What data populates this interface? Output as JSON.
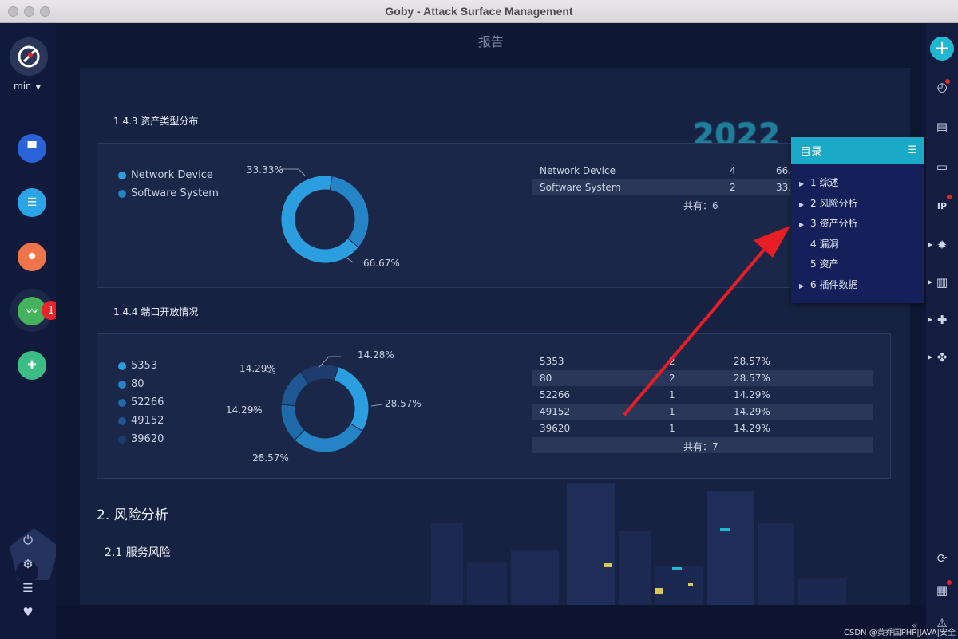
{
  "window": {
    "title": "Goby - Attack Surface Management"
  },
  "user": {
    "name": "mir"
  },
  "leftnav": {
    "badge_count": "1"
  },
  "page": {
    "title": "报告"
  },
  "logo_2022": "2022",
  "section_asset_types": {
    "title": "1.4.3 资产类型分布",
    "legend": [
      "Network Device",
      "Software System"
    ],
    "pct_top": "33.33%",
    "pct_bottom": "66.67%",
    "table": [
      {
        "name": "Network Device",
        "count": "4",
        "pct": "66.6"
      },
      {
        "name": "Software System",
        "count": "2",
        "pct": "33.3"
      }
    ],
    "total": "共有：6"
  },
  "section_ports": {
    "title": "1.4.4 端口开放情况",
    "legend": [
      "5353",
      "80",
      "52266",
      "49152",
      "39620"
    ],
    "labels": {
      "p1": "14.28%",
      "p2": "28.57%",
      "p3": "28.57%",
      "p4": "14.29%",
      "p5": "14.29%"
    },
    "table": [
      {
        "port": "5353",
        "count": "2",
        "pct": "28.57%"
      },
      {
        "port": "80",
        "count": "2",
        "pct": "28.57%"
      },
      {
        "port": "52266",
        "count": "1",
        "pct": "14.29%"
      },
      {
        "port": "49152",
        "count": "1",
        "pct": "14.29%"
      },
      {
        "port": "39620",
        "count": "1",
        "pct": "14.29%"
      }
    ],
    "total": "共有：7"
  },
  "risk": {
    "h2": "2. 风险分析",
    "h3": "2.1 服务风险"
  },
  "toc": {
    "title": "目录",
    "items": [
      "1 综述",
      "2 风险分析",
      "3 资产分析",
      "4 漏洞",
      "5 资产",
      "6 插件数据"
    ]
  },
  "watermark": "CSDN @黄乔国PHP|JAVA|安全",
  "colors": {
    "accent": "#1aa9c6",
    "donut_main": "#2b9ee0",
    "donut_dark": "#2063a8",
    "arrow": "#e81e26"
  },
  "chart_data": [
    {
      "type": "pie",
      "title": "1.4.3 资产类型分布",
      "categories": [
        "Network Device",
        "Software System"
      ],
      "values": [
        66.67,
        33.33
      ]
    },
    {
      "type": "pie",
      "title": "1.4.4 端口开放情况",
      "categories": [
        "5353",
        "80",
        "52266",
        "49152",
        "39620"
      ],
      "values": [
        28.57,
        28.57,
        14.29,
        14.29,
        14.28
      ]
    }
  ]
}
